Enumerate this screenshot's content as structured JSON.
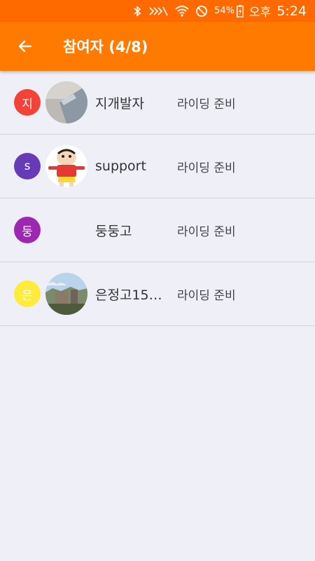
{
  "status_bar": {
    "battery": "54%",
    "ampm": "오후",
    "time": "5:24",
    "icons": [
      "bluetooth-icon",
      "mute-icon",
      "wifi-icon",
      "do-not-disturb-icon",
      "battery-charging-icon"
    ]
  },
  "app_bar": {
    "back_icon": "arrow-left-icon",
    "title": "참여자 (4/8)",
    "color": "#ff7a00"
  },
  "participants": [
    {
      "badge": "지",
      "badge_color": "#f44336",
      "avatar": "photo-gray-object",
      "name": "지개발자",
      "status": "라이딩 준비"
    },
    {
      "badge": "s",
      "badge_color": "#673ab7",
      "avatar": "cartoon-character",
      "name": "support",
      "status": "라이딩 준비"
    },
    {
      "badge": "둥",
      "badge_color": "#9c27b0",
      "avatar": "none",
      "name": "둥둥고",
      "status": "라이딩 준비"
    },
    {
      "badge": "은",
      "badge_color": "#ffeb3b",
      "avatar": "photo-landscape",
      "name": "은정고15…",
      "status": "라이딩 준비"
    }
  ]
}
